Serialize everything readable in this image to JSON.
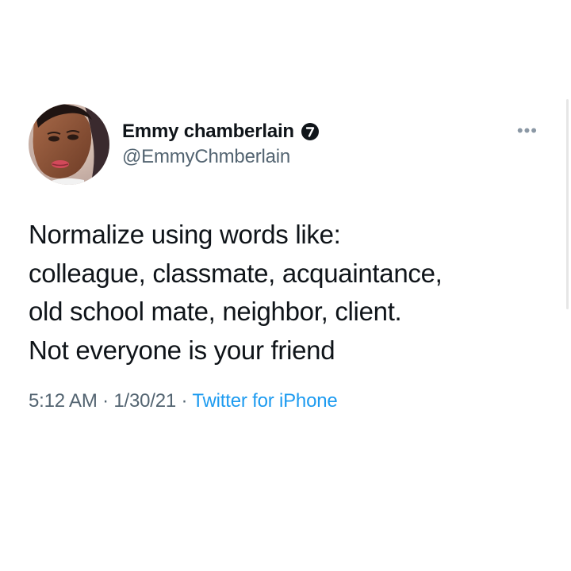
{
  "user": {
    "display_name": "Emmy chamberlain",
    "handle": "@EmmyChmberlain",
    "badge_icon": "verified-badge-icon"
  },
  "more_icon": "more-options-icon",
  "tweet": {
    "lines": [
      "Normalize using words like:",
      "colleague, classmate, acquaintance,",
      "old school mate, neighbor, client.",
      "Not everyone is your friend"
    ]
  },
  "meta": {
    "time": "5:12 AM",
    "separator": " · ",
    "date": "1/30/21",
    "separator2": " · ",
    "source": "Twitter for iPhone"
  },
  "colors": {
    "text": "#0f1419",
    "secondary": "#536471",
    "link": "#1d9bf0"
  }
}
